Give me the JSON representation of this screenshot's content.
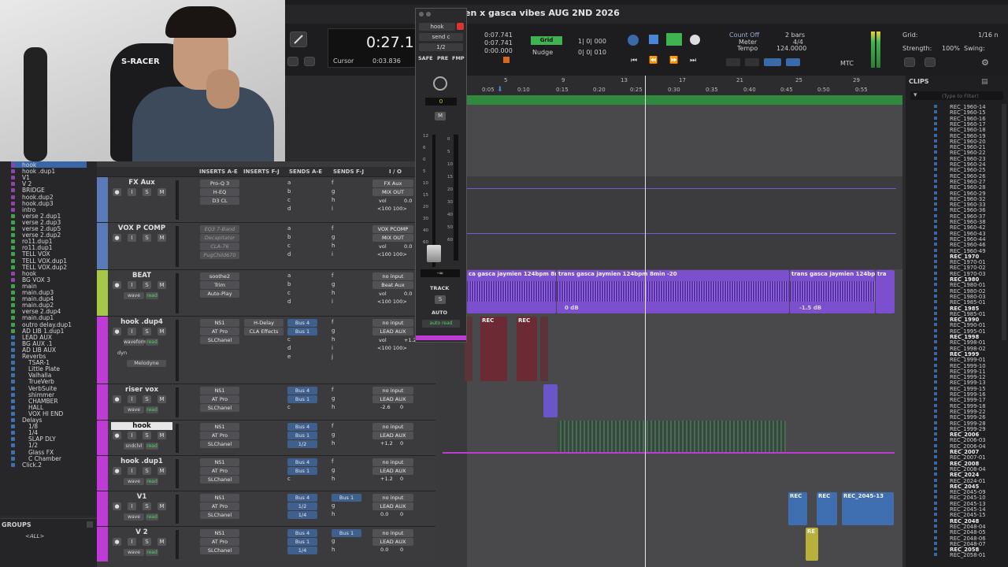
{
  "window": {
    "title": "en x gasca vibes AUG 2ND 2026"
  },
  "transport": {
    "main_counter": "0:27.11",
    "cursor_label": "Cursor",
    "cursor_value": "0:03.836",
    "sel_start": "0:07.741",
    "sel_end": "0:07.741",
    "sel_length": "0:00.000",
    "grid_label": "Grid",
    "grid_value": "1| 0| 000",
    "nudge_label": "Nudge",
    "nudge_value": "0| 0| 010",
    "count_off": "Count Off",
    "meter_label": "Meter",
    "tempo_label": "Tempo",
    "bars": "2 bars",
    "meter_value": "4/4",
    "tempo_value": "124.0000",
    "mtc": "MTC"
  },
  "grid_panel": {
    "grid_label": "Grid:",
    "grid_value": "1/16 n",
    "strength_label": "Strength:",
    "strength_value": "100%",
    "swing_label": "Swing:"
  },
  "float_mixer": {
    "track": "hook",
    "send": "send c",
    "ratio": "1/2",
    "safe": "SAFE",
    "pre": "PRE",
    "fmp": "FMP",
    "pan_value": "0",
    "mute": "M",
    "fader_value": "-∞",
    "track_label": "TRACK",
    "s": "S",
    "auto_label": "AUTO",
    "auto_mode": "auto read",
    "scale": [
      "12",
      "6",
      "0",
      "5",
      "10",
      "15",
      "20",
      "30",
      "40",
      "60"
    ],
    "meter_scale": [
      "0",
      "5",
      "10",
      "15",
      "20",
      "30",
      "40",
      "50",
      "60"
    ]
  },
  "column_headers": [
    "INSERTS A-E",
    "INSERTS F-J",
    "SENDS A-E",
    "SENDS F-J",
    "I / O"
  ],
  "tracklist": [
    {
      "name": "hook",
      "color": "#8e44ad"
    },
    {
      "name": "hook .dup1",
      "color": "#8e44ad"
    },
    {
      "name": "V1",
      "color": "#8e44ad"
    },
    {
      "name": "V 2",
      "color": "#8e44ad"
    },
    {
      "name": "BRIDGE",
      "color": "#8e44ad"
    },
    {
      "name": "hook.dup2",
      "color": "#8e44ad"
    },
    {
      "name": "hook.dup3",
      "color": "#8e44ad"
    },
    {
      "name": "intro",
      "color": "#8e44ad"
    },
    {
      "name": "verse 2.dup1",
      "color": "#3fa34d"
    },
    {
      "name": "verse 2.dup3",
      "color": "#3fa34d"
    },
    {
      "name": "verse 2.dup5",
      "color": "#3fa34d"
    },
    {
      "name": "verse 2.dup2",
      "color": "#3fa34d"
    },
    {
      "name": "ro11.dup1",
      "color": "#3fa34d"
    },
    {
      "name": "ro11.dup1",
      "color": "#3fa34d"
    },
    {
      "name": "TELL VOX",
      "color": "#3fa34d"
    },
    {
      "name": "TELL VOX.dup1",
      "color": "#3fa34d"
    },
    {
      "name": "TELL VOX.dup2",
      "color": "#3fa34d"
    },
    {
      "name": "hook",
      "color": "#8e44ad"
    },
    {
      "name": "BG VOX 3",
      "color": "#8e44ad"
    },
    {
      "name": "main",
      "color": "#3fa34d"
    },
    {
      "name": "main.dup3",
      "color": "#3fa34d"
    },
    {
      "name": "main.dup4",
      "color": "#3fa34d"
    },
    {
      "name": "main.dup2",
      "color": "#3fa34d"
    },
    {
      "name": "verse 2.dup4",
      "color": "#3fa34d"
    },
    {
      "name": "main.dup1",
      "color": "#3fa34d"
    },
    {
      "name": "outro delay.dup1",
      "color": "#3fa34d"
    },
    {
      "name": "AD LIB 1.dup1",
      "color": "#3fa34d"
    },
    {
      "name": "LEAD AUX",
      "color": "#3f6fb0"
    },
    {
      "name": "BG AUX .1",
      "color": "#3f6fb0"
    },
    {
      "name": "AD LIB AUX",
      "color": "#3f6fb0"
    },
    {
      "name": "Reverbs",
      "color": "#3f6fb0"
    },
    {
      "name": "TSAR-1",
      "color": "#3f6fb0"
    },
    {
      "name": "Little Plate",
      "color": "#3f6fb0"
    },
    {
      "name": "Valhalla",
      "color": "#3f6fb0"
    },
    {
      "name": "TrueVerb",
      "color": "#3f6fb0"
    },
    {
      "name": "VerbSuite",
      "color": "#3f6fb0"
    },
    {
      "name": "shimmer",
      "color": "#3f6fb0"
    },
    {
      "name": "CHAMBER",
      "color": "#3f6fb0"
    },
    {
      "name": "HALL",
      "color": "#3f6fb0"
    },
    {
      "name": "VOX HI END",
      "color": "#3f6fb0"
    },
    {
      "name": "Delays",
      "color": "#3f6fb0"
    },
    {
      "name": "1/8",
      "color": "#3f6fb0"
    },
    {
      "name": "1/4",
      "color": "#3f6fb0"
    },
    {
      "name": "SLAP DLY",
      "color": "#3f6fb0"
    },
    {
      "name": "1/2",
      "color": "#3f6fb0"
    },
    {
      "name": "Glass FX",
      "color": "#3f6fb0"
    },
    {
      "name": "C Chamber",
      "color": "#3f6fb0"
    },
    {
      "name": "Click.2",
      "color": "#3f6fb0"
    }
  ],
  "groups": {
    "title": "GROUPS",
    "all": "<ALL>"
  },
  "tracks": [
    {
      "name": "FX Aux",
      "inserts_a": [
        "Pro-Q 3",
        "H-EQ",
        "D3 CL"
      ],
      "inserts_f": [],
      "sends_a": [
        "a",
        "b",
        "c",
        "d"
      ],
      "sends_f": [
        "f",
        "g",
        "h",
        "i"
      ],
      "io": [
        "FX Aux",
        "MIX OUT"
      ],
      "vol": "vol",
      "vol_val": "0.0",
      "pan": "<100  100>"
    },
    {
      "name": "VOX P COMP",
      "inserts_a": [
        "EQ3 7-Band",
        "Decapitator",
        "CLA-76",
        "PugChild670"
      ],
      "inserts_f": [],
      "sends_a": [
        "a",
        "b",
        "c",
        "d"
      ],
      "sends_f": [
        "f",
        "g",
        "h",
        "i"
      ],
      "io": [
        "VOX PCOMP",
        "MIX OUT"
      ],
      "vol": "vol",
      "vol_val": "0.0",
      "pan": "<100  100>"
    },
    {
      "name": "BEAT",
      "inserts_a": [
        "soothe2",
        "Trim",
        "Auto-Play"
      ],
      "inserts_f": [],
      "sends_a": [
        "a",
        "b",
        "c",
        "d"
      ],
      "sends_f": [
        "f",
        "g",
        "h",
        "i"
      ],
      "io": [
        "no input",
        "Beat Aux"
      ],
      "vol": "vol",
      "vol_val": "0.0",
      "pan": "<100  100>",
      "mode": "wave",
      "auto": "read"
    },
    {
      "name": "hook .dup4",
      "inserts_a": [
        "NS1",
        "AT Pro",
        "SLChanel"
      ],
      "inserts_f": [
        "H-Delay",
        "CLA Effects"
      ],
      "sends_a": [
        "Bus 4",
        "Bus 1",
        "c",
        "d",
        "e"
      ],
      "sends_f": [
        "f",
        "g",
        "h",
        "i",
        "j"
      ],
      "io": [
        "no input",
        "LEAD AUX"
      ],
      "vol": "vol",
      "vol_val": "+1.2",
      "pan": "<100  100>",
      "mode": "waveform",
      "auto": "read",
      "dyn": "dyn",
      "melodyne": "Melodyne"
    },
    {
      "name": "riser vox",
      "inserts_a": [
        "NS1",
        "AT Pro",
        "SLChanel"
      ],
      "inserts_f": [],
      "sends_a": [
        "Bus 4",
        "Bus 1",
        "c"
      ],
      "sends_f": [
        "f",
        "g",
        "h"
      ],
      "io": [
        "no input",
        "LEAD AUX"
      ],
      "vol_val": "-2.6",
      "pan": "0",
      "mode": "wave",
      "auto": "read"
    },
    {
      "name": "hook",
      "inserts_a": [
        "NS1",
        "AT Pro",
        "SLChanel"
      ],
      "inserts_f": [],
      "sends_a": [
        "Bus 4",
        "Bus 1",
        "1/2"
      ],
      "sends_f": [
        "f",
        "g",
        "h"
      ],
      "io": [
        "no input",
        "LEAD AUX"
      ],
      "vol_val": "+1.2",
      "pan": "0",
      "mode": "sndclvl",
      "auto": "read"
    },
    {
      "name": "hook .dup1",
      "inserts_a": [
        "NS1",
        "AT Pro",
        "SLChanel"
      ],
      "inserts_f": [],
      "sends_a": [
        "Bus 4",
        "Bus 1",
        "c"
      ],
      "sends_f": [
        "f",
        "g",
        "h"
      ],
      "io": [
        "no input",
        "LEAD AUX"
      ],
      "vol_val": "+1.2",
      "pan": "0",
      "mode": "wave",
      "auto": "read"
    },
    {
      "name": "V1",
      "inserts_a": [
        "NS1",
        "AT Pro",
        "SLChanel"
      ],
      "inserts_f": [],
      "sends_a": [
        "Bus 4",
        "1/2",
        "1/4"
      ],
      "sends_f": [
        "Bus 1",
        "g",
        "h"
      ],
      "io": [
        "no input",
        "LEAD AUX"
      ],
      "vol_val": "0.0",
      "pan": "0",
      "mode": "wave",
      "auto": "read"
    },
    {
      "name": "V 2",
      "inserts_a": [
        "NS1",
        "AT Pro",
        "SLChanel"
      ],
      "inserts_f": [],
      "sends_a": [
        "Bus 4",
        "Bus 1",
        "1/4"
      ],
      "sends_f": [
        "Bus 1",
        "g",
        "h"
      ],
      "io": [
        "no input",
        "LEAD AUX"
      ],
      "vol_val": "0.0",
      "pan": "0",
      "mode": "wave",
      "auto": "read"
    }
  ],
  "ruler": {
    "bars": [
      "5",
      "9",
      "13",
      "17",
      "21",
      "25",
      "29"
    ],
    "times": [
      "0:05",
      "0:10",
      "0:15",
      "0:20",
      "0:25",
      "0:30",
      "0:35",
      "0:40",
      "0:45",
      "0:50",
      "0:55"
    ]
  },
  "clips_timeline": {
    "beat_1": "ca gasca jaymien 124bpm 8min -03",
    "beat_2": "trans gasca jaymien 124bpm 8min -20",
    "beat_3": "trans gasca jaymien 124bpr",
    "beat_4": "tra",
    "beat_db1": "0 dB",
    "beat_db2": "-1.5 dB",
    "rec": "REC",
    "rec_long": "REC_2045-13",
    "re": "RE"
  },
  "clips_panel": {
    "title": "CLIPS",
    "filter": "(Type to Filter)",
    "items": [
      {
        "name": "REC_1960-14",
        "bold": false
      },
      {
        "name": "REC_1960-15",
        "bold": false
      },
      {
        "name": "REC_1960-16",
        "bold": false
      },
      {
        "name": "REC_1960-17",
        "bold": false
      },
      {
        "name": "REC_1960-18",
        "bold": false
      },
      {
        "name": "REC_1960-19",
        "bold": false
      },
      {
        "name": "REC_1960-20",
        "bold": false
      },
      {
        "name": "REC_1960-21",
        "bold": false
      },
      {
        "name": "REC_1960-22",
        "bold": false
      },
      {
        "name": "REC_1960-23",
        "bold": false
      },
      {
        "name": "REC_1960-24",
        "bold": false
      },
      {
        "name": "REC_1960-25",
        "bold": false
      },
      {
        "name": "REC_1960-26",
        "bold": false
      },
      {
        "name": "REC_1960-27",
        "bold": false
      },
      {
        "name": "REC_1960-28",
        "bold": false
      },
      {
        "name": "REC_1960-29",
        "bold": false
      },
      {
        "name": "REC_1960-32",
        "bold": false
      },
      {
        "name": "REC_1960-33",
        "bold": false
      },
      {
        "name": "REC_1960-36",
        "bold": false
      },
      {
        "name": "REC_1960-37",
        "bold": false
      },
      {
        "name": "REC_1960-38",
        "bold": false
      },
      {
        "name": "REC_1960-42",
        "bold": false
      },
      {
        "name": "REC_1960-43",
        "bold": false
      },
      {
        "name": "REC_1960-44",
        "bold": false
      },
      {
        "name": "REC_1960-46",
        "bold": false
      },
      {
        "name": "REC_1960-49",
        "bold": false
      },
      {
        "name": "REC_1970",
        "bold": true
      },
      {
        "name": "REC_1970-01",
        "bold": false
      },
      {
        "name": "REC_1970-02",
        "bold": false
      },
      {
        "name": "REC_1970-03",
        "bold": false
      },
      {
        "name": "REC_1980",
        "bold": true
      },
      {
        "name": "REC_1980-01",
        "bold": false
      },
      {
        "name": "REC_1980-02",
        "bold": false
      },
      {
        "name": "REC_1980-03",
        "bold": false
      },
      {
        "name": "REC_1985-01",
        "bold": false
      },
      {
        "name": "REC_1985",
        "bold": true
      },
      {
        "name": "REC_1985-01",
        "bold": false
      },
      {
        "name": "REC_1990",
        "bold": true
      },
      {
        "name": "REC_1990-01",
        "bold": false
      },
      {
        "name": "REC_1995-01",
        "bold": false
      },
      {
        "name": "REC_1998",
        "bold": true
      },
      {
        "name": "REC_1998-01",
        "bold": false
      },
      {
        "name": "REC_1998-02",
        "bold": false
      },
      {
        "name": "REC_1999",
        "bold": true
      },
      {
        "name": "REC_1999-01",
        "bold": false
      },
      {
        "name": "REC_1999-10",
        "bold": false
      },
      {
        "name": "REC_1999-11",
        "bold": false
      },
      {
        "name": "REC_1999-12",
        "bold": false
      },
      {
        "name": "REC_1999-13",
        "bold": false
      },
      {
        "name": "REC_1999-15",
        "bold": false
      },
      {
        "name": "REC_1999-16",
        "bold": false
      },
      {
        "name": "REC_1999-17",
        "bold": false
      },
      {
        "name": "REC_1999-18",
        "bold": false
      },
      {
        "name": "REC_1999-22",
        "bold": false
      },
      {
        "name": "REC_1999-26",
        "bold": false
      },
      {
        "name": "REC_1999-28",
        "bold": false
      },
      {
        "name": "REC_1999-29",
        "bold": false
      },
      {
        "name": "REC_2006",
        "bold": true
      },
      {
        "name": "REC_2006-03",
        "bold": false
      },
      {
        "name": "REC_2006-04",
        "bold": false
      },
      {
        "name": "REC_2007",
        "bold": true
      },
      {
        "name": "REC_2007-01",
        "bold": false
      },
      {
        "name": "REC_2008",
        "bold": true
      },
      {
        "name": "REC_2008-04",
        "bold": false
      },
      {
        "name": "REC_2024",
        "bold": true
      },
      {
        "name": "REC_2024-01",
        "bold": false
      },
      {
        "name": "REC_2045",
        "bold": true
      },
      {
        "name": "REC_2045-09",
        "bold": false
      },
      {
        "name": "REC_2045-10",
        "bold": false
      },
      {
        "name": "REC_2045-13",
        "bold": false
      },
      {
        "name": "REC_2045-14",
        "bold": false
      },
      {
        "name": "REC_2045-15",
        "bold": false
      },
      {
        "name": "REC_2048",
        "bold": true
      },
      {
        "name": "REC_2048-04",
        "bold": false
      },
      {
        "name": "REC_2048-05",
        "bold": false
      },
      {
        "name": "REC_2048-06",
        "bold": false
      },
      {
        "name": "REC_2048-07",
        "bold": false
      },
      {
        "name": "REC_2058",
        "bold": true
      },
      {
        "name": "REC_2058-01",
        "bold": false
      }
    ]
  }
}
